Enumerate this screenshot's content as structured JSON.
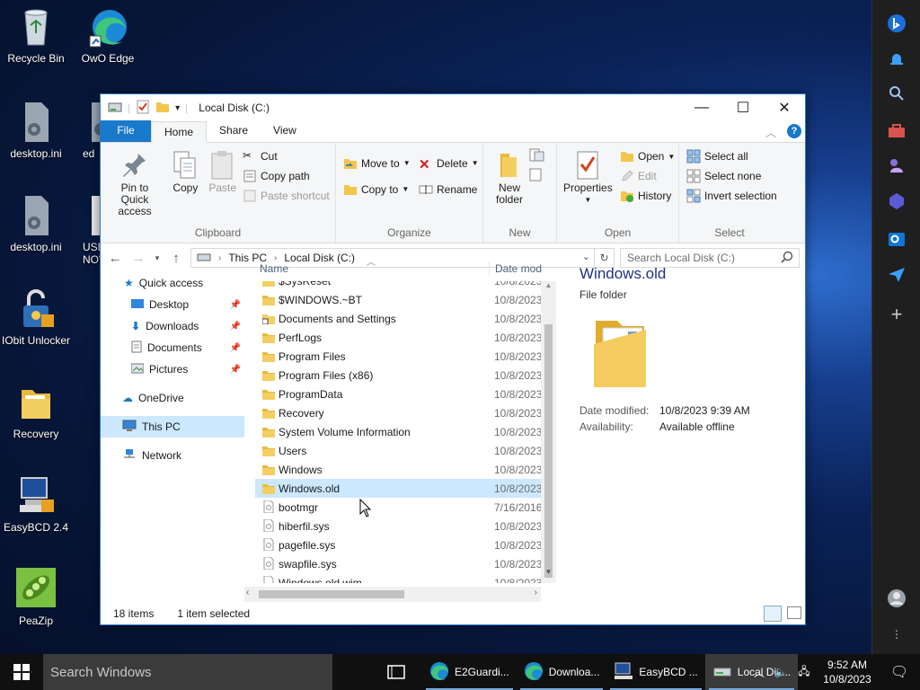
{
  "desktop": {
    "icons": [
      {
        "label": "Recycle Bin",
        "icon": "recycle-bin-icon"
      },
      {
        "label": "OwO Edge",
        "icon": "edge-icon"
      },
      {
        "label": "desktop.ini",
        "icon": "settings-file-icon"
      },
      {
        "label": "ed",
        "icon": "settings-file-icon"
      },
      {
        "label": "desktop.ini",
        "icon": "settings-file-icon"
      },
      {
        "label": "USB NOW",
        "icon": "file-icon"
      },
      {
        "label": "IObit Unlocker",
        "icon": "iobit-unlocker-icon"
      },
      {
        "label": "Recovery",
        "icon": "folder-icon"
      },
      {
        "label": "EasyBCD 2.4",
        "icon": "easybcd-icon"
      },
      {
        "label": "PeaZip",
        "icon": "peazip-icon"
      }
    ]
  },
  "window": {
    "title": "Local Disk (C:)",
    "tabs": [
      "File",
      "Home",
      "Share",
      "View"
    ],
    "ribbon": {
      "clipboard": {
        "label": "Clipboard",
        "pin": "Pin to Quick access",
        "copy": "Copy",
        "paste": "Paste",
        "cut": "Cut",
        "copy_path": "Copy path",
        "paste_shortcut": "Paste shortcut"
      },
      "organize": {
        "label": "Organize",
        "move_to": "Move to",
        "copy_to": "Copy to",
        "delete": "Delete",
        "rename": "Rename"
      },
      "new": {
        "label": "New",
        "new_folder": "New folder"
      },
      "open": {
        "label": "Open",
        "properties": "Properties",
        "open": "Open",
        "edit": "Edit",
        "history": "History"
      },
      "select": {
        "label": "Select",
        "select_all": "Select all",
        "select_none": "Select none",
        "invert": "Invert selection"
      }
    },
    "address": {
      "crumbs": [
        "This PC",
        "Local Disk (C:)"
      ],
      "search_placeholder": "Search Local Disk (C:)"
    },
    "nav": [
      {
        "label": "Quick access",
        "icon": "star-icon"
      },
      {
        "label": "Desktop",
        "icon": "desktop-icon",
        "pinned": true
      },
      {
        "label": "Downloads",
        "icon": "download-icon",
        "pinned": true
      },
      {
        "label": "Documents",
        "icon": "documents-icon",
        "pinned": true
      },
      {
        "label": "Pictures",
        "icon": "pictures-icon",
        "pinned": true
      },
      {
        "label": "OneDrive",
        "icon": "cloud-icon"
      },
      {
        "label": "This PC",
        "icon": "computer-icon"
      },
      {
        "label": "Network",
        "icon": "network-icon"
      }
    ],
    "columns": {
      "name": "Name",
      "date": "Date mod"
    },
    "files": [
      {
        "name": "$SysReset",
        "date": "10/8/2023",
        "type": "folder"
      },
      {
        "name": "$WINDOWS.~BT",
        "date": "10/8/2023",
        "type": "folder"
      },
      {
        "name": "Documents and Settings",
        "date": "10/8/2023",
        "type": "shortcut"
      },
      {
        "name": "PerfLogs",
        "date": "10/8/2023",
        "type": "folder"
      },
      {
        "name": "Program Files",
        "date": "10/8/2023",
        "type": "folder"
      },
      {
        "name": "Program Files (x86)",
        "date": "10/8/2023",
        "type": "folder"
      },
      {
        "name": "ProgramData",
        "date": "10/8/2023",
        "type": "folder"
      },
      {
        "name": "Recovery",
        "date": "10/8/2023",
        "type": "folder"
      },
      {
        "name": "System Volume Information",
        "date": "10/8/2023",
        "type": "folder"
      },
      {
        "name": "Users",
        "date": "10/8/2023",
        "type": "folder"
      },
      {
        "name": "Windows",
        "date": "10/8/2023",
        "type": "folder"
      },
      {
        "name": "Windows.old",
        "date": "10/8/2023",
        "type": "folder",
        "selected": true
      },
      {
        "name": "bootmgr",
        "date": "7/16/2016",
        "type": "sys"
      },
      {
        "name": "hiberfil.sys",
        "date": "10/8/2023",
        "type": "sys"
      },
      {
        "name": "pagefile.sys",
        "date": "10/8/2023",
        "type": "sys"
      },
      {
        "name": "swapfile.sys",
        "date": "10/8/2023",
        "type": "sys"
      },
      {
        "name": "Windows.old.wim",
        "date": "10/8/2023",
        "type": "file"
      }
    ],
    "preview": {
      "name": "Windows.old",
      "type": "File folder",
      "date_label": "Date modified:",
      "date_value": "10/8/2023 9:39 AM",
      "avail_label": "Availability:",
      "avail_value": "Available offline"
    },
    "status": {
      "items": "18 items",
      "selected": "1 item selected"
    }
  },
  "taskbar": {
    "search_placeholder": "Search Windows",
    "apps": [
      {
        "label": "E2Guardi...",
        "icon": "edge-icon"
      },
      {
        "label": "Downloa...",
        "icon": "edge-icon"
      },
      {
        "label": "EasyBCD ...",
        "icon": "easybcd-icon"
      },
      {
        "label": "Local Dis...",
        "icon": "file-explorer-icon"
      }
    ],
    "time": "9:52 AM",
    "date": "10/8/2023"
  },
  "colors": {
    "accent": "#1979ca",
    "selection": "#cce8ff",
    "folder": "#f3c64b"
  }
}
